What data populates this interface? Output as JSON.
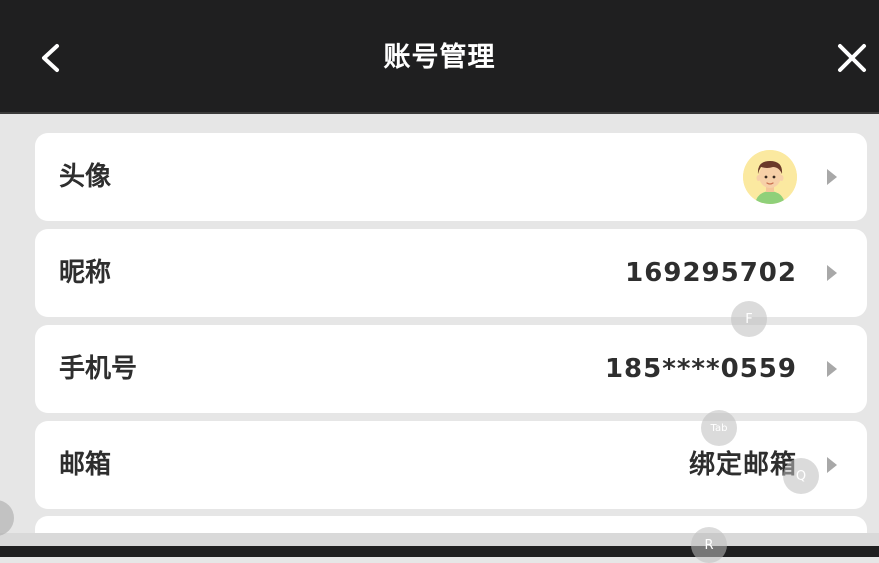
{
  "header": {
    "title": "账号管理",
    "back_icon": "chevron-left-icon",
    "close_icon": "close-icon"
  },
  "rows": [
    {
      "label": "头像",
      "value": "",
      "type": "avatar"
    },
    {
      "label": "昵称",
      "value": "169295702",
      "type": "text"
    },
    {
      "label": "手机号",
      "value": "185****0559",
      "type": "text"
    },
    {
      "label": "邮箱",
      "value": "绑定邮箱",
      "type": "text"
    }
  ],
  "key_hints": [
    "F",
    "Tab",
    "Q",
    "R"
  ],
  "colors": {
    "header_bg": "#1f1f20",
    "page_bg": "#e6e6e6",
    "card_bg": "#ffffff",
    "text": "#2e2e2e",
    "chevron": "#a8a8a8"
  }
}
